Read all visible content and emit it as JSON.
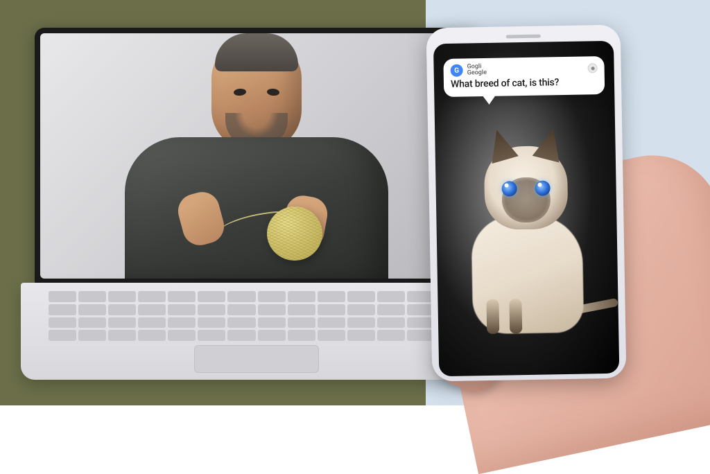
{
  "assistant": {
    "brand_line1": "Gogli",
    "brand_line2": "Geogle",
    "icon_glyph": "G",
    "query_text": "What breed of cat, is this?"
  },
  "scene": {
    "laptop_subject": "man-holding-yarn-ball",
    "phone_subject": "siamese-cat",
    "yarn_color": "#d4c670",
    "cat_eye_color": "#2a6bd4"
  }
}
